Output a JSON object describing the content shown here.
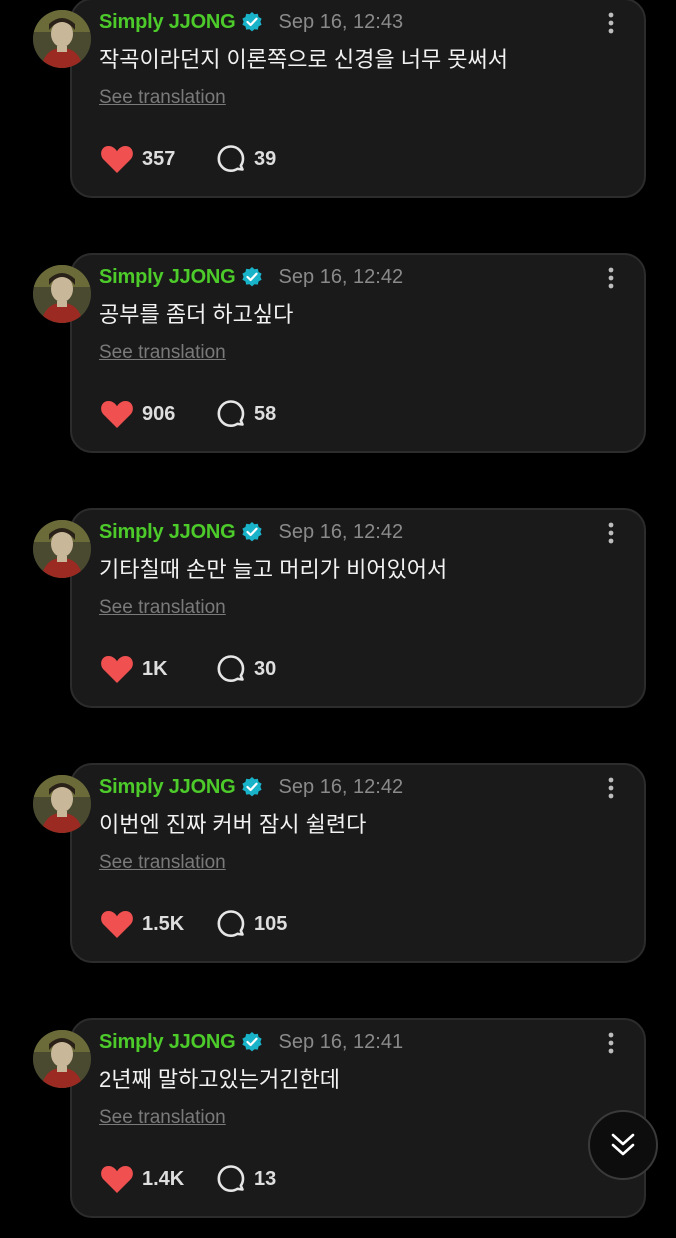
{
  "posts": [
    {
      "username": "Simply JJONG",
      "timestamp": "Sep 16, 12:43",
      "text": "작곡이라던지 이론쪽으로 신경을 너무 못써서",
      "translate_label": "See translation",
      "likes": "357",
      "comments": "39"
    },
    {
      "username": "Simply JJONG",
      "timestamp": "Sep 16, 12:42",
      "text": "공부를 좀더 하고싶다",
      "translate_label": "See translation",
      "likes": "906",
      "comments": "58"
    },
    {
      "username": "Simply JJONG",
      "timestamp": "Sep 16, 12:42",
      "text": "기타칠때 손만 늘고 머리가 비어있어서",
      "translate_label": "See translation",
      "likes": "1K",
      "comments": "30"
    },
    {
      "username": "Simply JJONG",
      "timestamp": "Sep 16, 12:42",
      "text": "이번엔 진짜 커버 잠시 쉴련다",
      "translate_label": "See translation",
      "likes": "1.5K",
      "comments": "105"
    },
    {
      "username": "Simply JJONG",
      "timestamp": "Sep 16, 12:41",
      "text": "2년째 말하고있는거긴한데",
      "translate_label": "See translation",
      "likes": "1.4K",
      "comments": "13"
    }
  ],
  "icons": {
    "verified": "verified-badge-icon",
    "more": "more-vertical-icon",
    "like": "heart-icon",
    "comment": "comment-bubble-icon",
    "scroll": "double-chevron-down-icon"
  },
  "colors": {
    "background": "#000000",
    "card": "#1a1a1a",
    "card_border": "#2c2c2c",
    "username": "#4ccb2a",
    "verified": "#19b3c9",
    "timestamp": "#8a8a8a",
    "heart": "#f0504f",
    "link": "#7a7a7a"
  }
}
